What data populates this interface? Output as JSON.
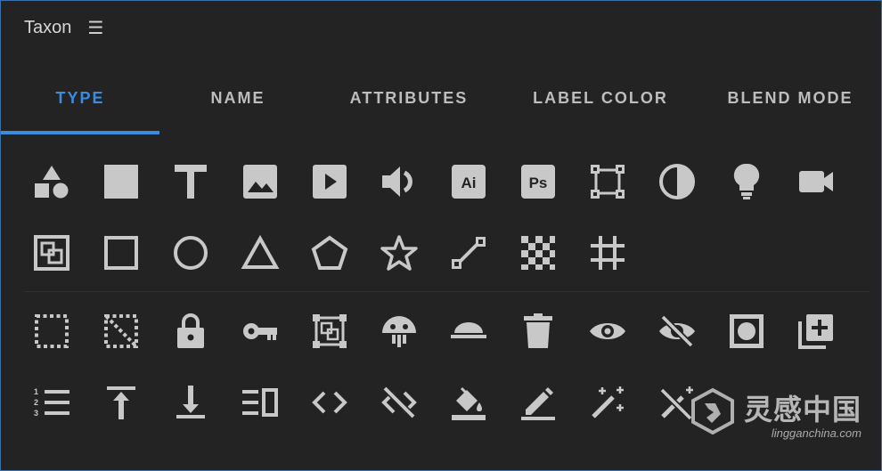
{
  "header": {
    "title": "Taxon",
    "menu_icon": "hamburger-menu-icon"
  },
  "tabs": [
    {
      "label": "TYPE",
      "active": true
    },
    {
      "label": "NAME",
      "active": false
    },
    {
      "label": "ATTRIBUTES",
      "active": false
    },
    {
      "label": "LABEL COLOR",
      "active": false
    },
    {
      "label": "BLEND MODE",
      "active": false
    }
  ],
  "accent_color": "#3b8ce0",
  "icon_rows": [
    [
      "shapes-icon",
      "solid-layer-icon",
      "text-layer-icon",
      "image-icon",
      "video-play-icon",
      "audio-icon",
      "illustrator-file-icon",
      "photoshop-file-icon",
      "null-object-icon",
      "adjustment-layer-icon",
      "light-icon",
      "camera-icon"
    ],
    [
      "precomp-icon",
      "rectangle-icon",
      "ellipse-icon",
      "triangle-icon",
      "pentagon-icon",
      "star-icon",
      "path-icon",
      "transparency-grid-icon",
      "guide-grid-icon"
    ],
    [
      "selection-dotted-icon",
      "selection-excluded-icon",
      "lock-icon",
      "key-icon",
      "precomp-select-icon",
      "solo-icon",
      "shy-icon",
      "trash-icon",
      "visible-eye-icon",
      "hidden-eye-icon",
      "effect-layer-icon",
      "add-layer-icon"
    ],
    [
      "numbered-list-icon",
      "align-top-icon",
      "align-bottom-icon",
      "align-distribute-icon",
      "code-icon",
      "code-off-icon",
      "fill-color-icon",
      "edit-pencil-icon",
      "magic-wand-icon",
      "magic-wand-off-icon"
    ]
  ],
  "icon_glyphs": {
    "illustrator-file-icon": "Ai",
    "photoshop-file-icon": "Ps"
  },
  "watermark": {
    "cn": "灵感中国",
    "en": "lingganchina.com"
  }
}
